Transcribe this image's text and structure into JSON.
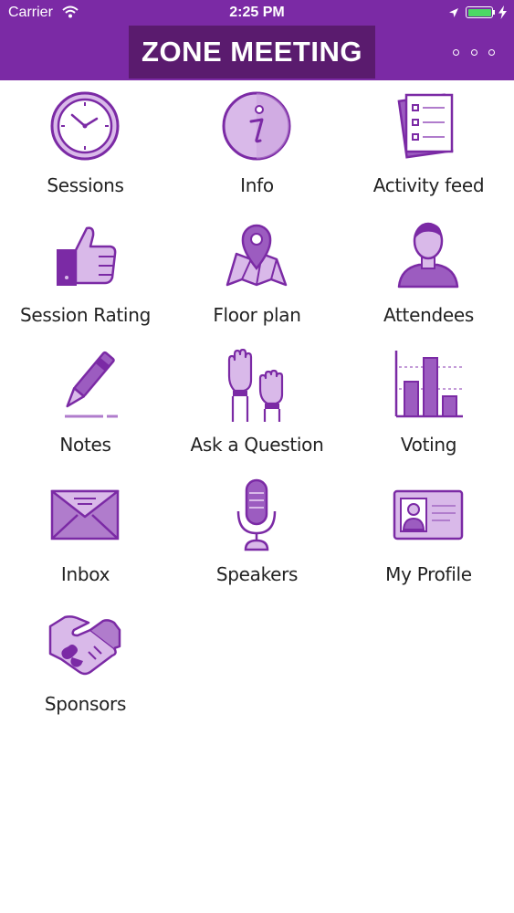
{
  "status_bar": {
    "carrier": "Carrier",
    "time": "2:25 PM",
    "battery_level": 1.0
  },
  "header": {
    "title": "ZONE MEETING"
  },
  "colors": {
    "header_background": "#7b2aa5",
    "title_background": "#5a1b6e",
    "icon_dark": "#7b2aa5",
    "icon_light": "#d9b9e9",
    "icon_mid": "#b07ccc"
  },
  "menu": {
    "items": [
      {
        "label": "Sessions",
        "icon": "clock-icon"
      },
      {
        "label": "Info",
        "icon": "info-icon"
      },
      {
        "label": "Activity feed",
        "icon": "checklist-icon"
      },
      {
        "label": "Session Rating",
        "icon": "thumbs-up-icon"
      },
      {
        "label": "Floor plan",
        "icon": "map-pin-icon"
      },
      {
        "label": "Attendees",
        "icon": "person-icon"
      },
      {
        "label": "Notes",
        "icon": "pen-icon"
      },
      {
        "label": "Ask a Question",
        "icon": "raised-hands-icon"
      },
      {
        "label": "Voting",
        "icon": "bar-chart-icon"
      },
      {
        "label": "Inbox",
        "icon": "envelope-icon"
      },
      {
        "label": "Speakers",
        "icon": "microphone-icon"
      },
      {
        "label": "My Profile",
        "icon": "id-card-icon"
      },
      {
        "label": "Sponsors",
        "icon": "handshake-icon"
      }
    ]
  }
}
